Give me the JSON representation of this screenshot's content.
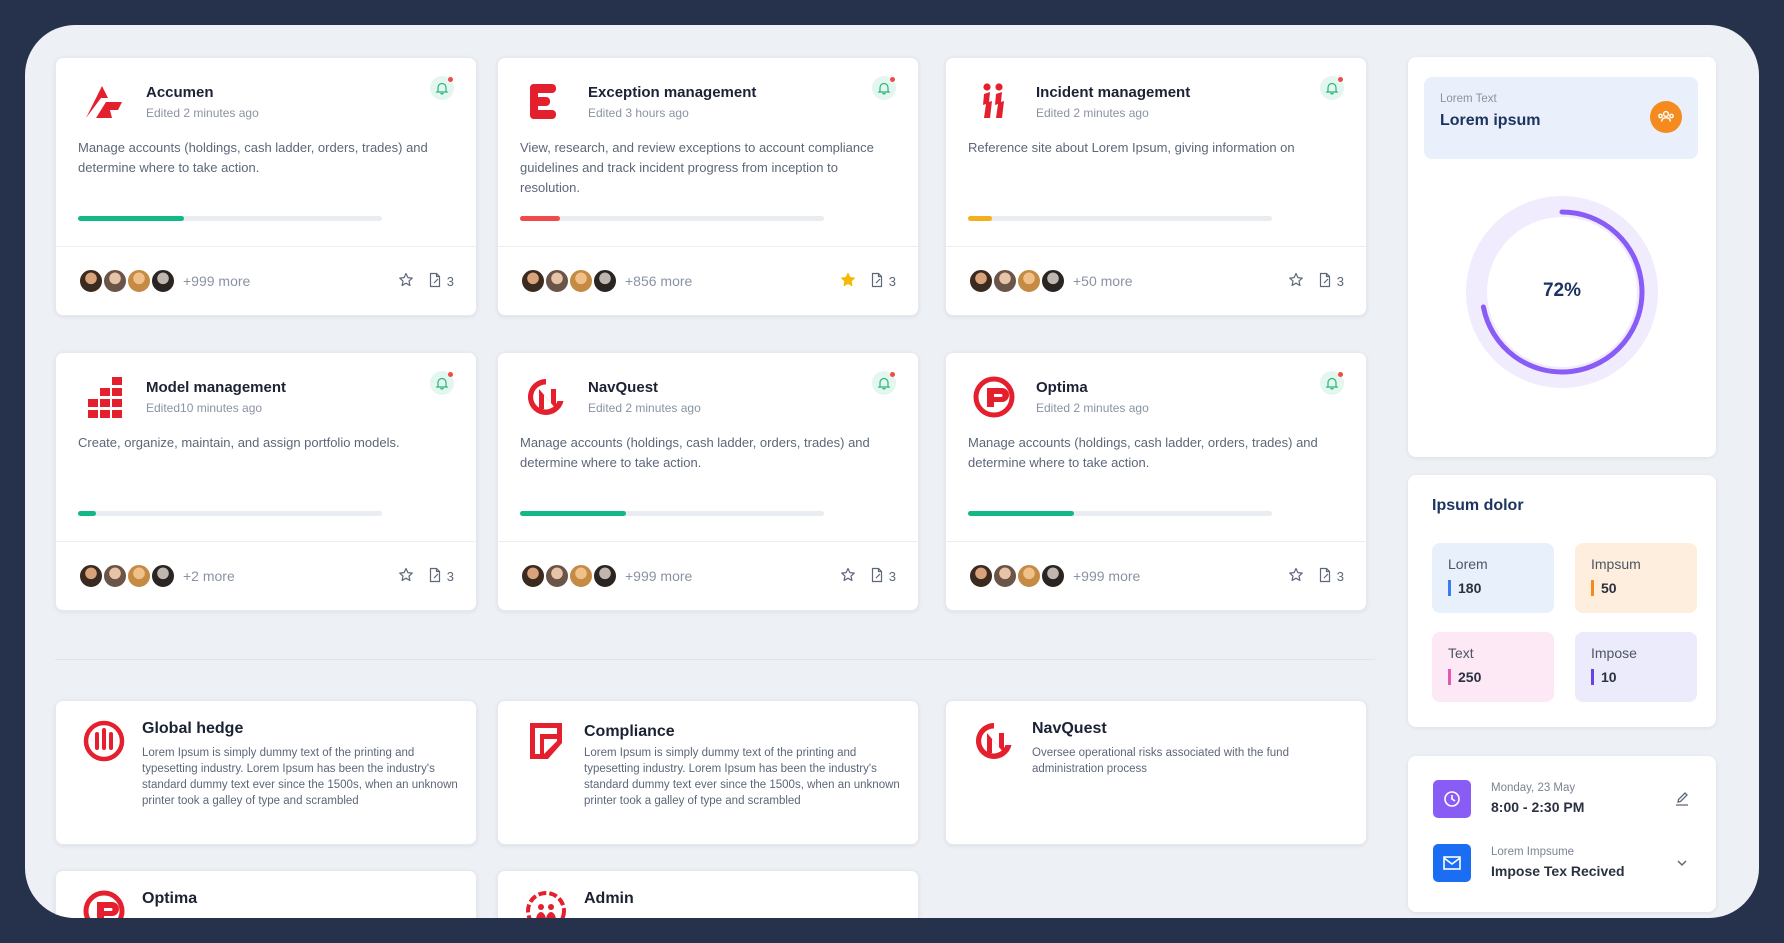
{
  "apps": [
    {
      "title": "Accumen",
      "edited": "Edited 2 minutes ago",
      "desc": "Manage accounts (holdings, cash ladder, orders, trades) and determine where to take action.",
      "progress": 35,
      "bar_color": "#12b886",
      "more": "+999 more",
      "starred": false,
      "docs": "3",
      "logo": "accumen-logo"
    },
    {
      "title": "Exception management",
      "edited": "Edited 3 hours ago",
      "desc": "View, research, and review exceptions to account compliance guidelines and track incident progress from inception to resolution.",
      "progress": 13,
      "bar_color": "#f04a4a",
      "more": "+856 more",
      "starred": true,
      "docs": "3",
      "logo": "exception-logo"
    },
    {
      "title": "Incident management",
      "edited": "Edited 2 minutes ago",
      "desc": "Reference site about Lorem Ipsum, giving information on",
      "progress": 8,
      "bar_color": "#f2b01e",
      "more": "+50 more",
      "starred": false,
      "docs": "3",
      "logo": "incident-logo"
    },
    {
      "title": "Model management",
      "edited": "Edited10 minutes ago",
      "desc": "Create, organize, maintain, and assign portfolio models.",
      "progress": 6,
      "bar_color": "#12b886",
      "more": "+2 more",
      "starred": false,
      "docs": "3",
      "logo": "model-logo"
    },
    {
      "title": "NavQuest",
      "edited": "Edited 2 minutes ago",
      "desc": "Manage accounts (holdings, cash ladder, orders, trades) and determine where to take action.",
      "progress": 35,
      "bar_color": "#12b886",
      "more": "+999 more",
      "starred": false,
      "docs": "3",
      "logo": "navquest-logo"
    },
    {
      "title": "Optima",
      "edited": "Edited 2 minutes ago",
      "desc": "Manage accounts (holdings, cash ladder, orders, trades) and determine where to take action.",
      "progress": 35,
      "bar_color": "#12b886",
      "more": "+999 more",
      "starred": false,
      "docs": "3",
      "logo": "optima-logo"
    }
  ],
  "wide": [
    {
      "title": "Global hedge",
      "desc": "Lorem Ipsum is simply dummy text of the printing and typesetting industry. Lorem Ipsum has been the industry's standard dummy text ever since the 1500s, when an unknown printer took a galley of type and scrambled",
      "logo": "global-hedge-logo"
    },
    {
      "title": "Compliance",
      "desc": "Lorem Ipsum is simply dummy text of the printing and typesetting industry. Lorem Ipsum has been the industry's standard dummy text ever since the 1500s, when an unknown printer took a galley of type and scrambled",
      "logo": "compliance-logo"
    },
    {
      "title": "NavQuest",
      "desc": "Oversee operational risks associated with the fund administration process",
      "logo": "navquest-logo"
    },
    {
      "title": "Optima",
      "desc": "",
      "logo": "optima-logo"
    },
    {
      "title": "Admin",
      "desc": "",
      "logo": "admin-logo"
    }
  ],
  "summary": {
    "subtitle": "Lorem Text",
    "title": "Lorem  ipsum",
    "percent": "72%",
    "percent_value": 72,
    "ring_color": "#8a5cf6"
  },
  "stats": {
    "title": "Ipsum dolor",
    "tiles": [
      {
        "label": "Lorem",
        "value": "180",
        "bg": "#e8f0fc",
        "accent": "#3b7bf6"
      },
      {
        "label": "Impsum",
        "value": "50",
        "bg": "#fdeedd",
        "accent": "#f58b1f"
      },
      {
        "label": "Text",
        "value": "250",
        "bg": "#fde8f5",
        "accent": "#e656b4"
      },
      {
        "label": "Impose",
        "value": "10",
        "bg": "#ecebfb",
        "accent": "#6b42e8"
      }
    ]
  },
  "events": [
    {
      "sub": "Monday, 23 May",
      "title": "8:00 - 2:30 PM",
      "icon": "clock-icon",
      "action": "edit-icon",
      "color": "#8a5cf6"
    },
    {
      "sub": "Lorem Impsume",
      "title": "Impose Tex Recived",
      "icon": "mail-icon",
      "action": "chevron-down-icon",
      "color": "#1b6ef3"
    }
  ]
}
